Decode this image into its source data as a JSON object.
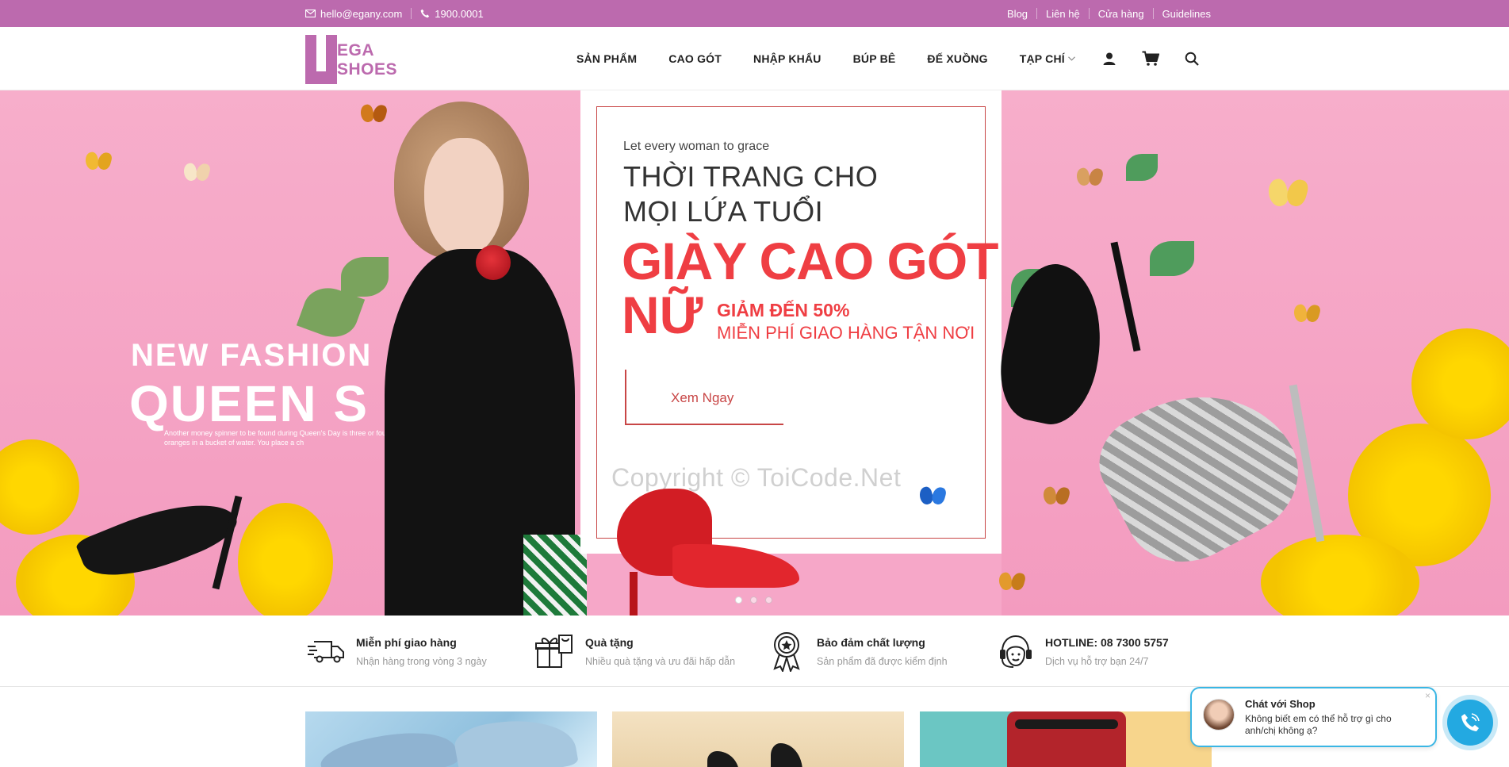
{
  "topbar": {
    "email": "hello@egany.com",
    "phone": "1900.0001",
    "links": [
      "Blog",
      "Liên hệ",
      "Cửa hàng",
      "Guidelines"
    ]
  },
  "logo": {
    "line1": "EGA",
    "line2": "SHOES"
  },
  "nav": {
    "items": [
      "SẢN PHẨM",
      "CAO GÓT",
      "NHẬP KHẨU",
      "BÚP BÊ",
      "ĐẾ XUỒNG",
      "TẠP CHÍ"
    ],
    "icons": [
      "user-icon",
      "cart-icon",
      "search-icon"
    ]
  },
  "hero": {
    "left_small": "NEW FASHION",
    "left_big": "QUEEN S",
    "left_desc": "Another money spinner to be found during Queen's Day is three or four oranges in a bucket of water. You place a ch",
    "tagline": "Let every woman to grace",
    "headline": "THỜI TRANG CHO MỌI LỨA TUỔI",
    "product_line1": "GIÀY CAO GÓT",
    "product_line2": "NỮ",
    "promo_discount": "GIẢM ĐẾN 50%",
    "promo_shipping": "MIỄN PHÍ GIAO HÀNG TẬN NƠI",
    "cta": "Xem Ngay",
    "watermark": "Copyright © ToiCode.Net",
    "slides": 3,
    "active_slide": 1
  },
  "services": [
    {
      "title": "Miễn phí giao hàng",
      "subtitle": "Nhận hàng trong vòng 3 ngày",
      "icon": "delivery-truck-icon"
    },
    {
      "title": "Quà tặng",
      "subtitle": "Nhiều quà tặng và ưu đãi hấp dẫn",
      "icon": "gift-icon"
    },
    {
      "title": "Bảo đảm chất lượng",
      "subtitle": "Sản phẩm đã được kiểm định",
      "icon": "quality-badge-icon"
    },
    {
      "title": "HOTLINE: 08 7300 5757",
      "subtitle": "Dịch vụ hỗ trợ bạn 24/7",
      "icon": "headset-icon"
    }
  ],
  "chat": {
    "title": "Chát với Shop",
    "message": "Không biết em có thể hỗ trợ gì cho anh/chị không ạ?",
    "close": "×"
  },
  "colors": {
    "brand": "#bc6aae",
    "accent_red": "#ef3e43",
    "hero_pink": "#f6a7c8",
    "chat_blue": "#23a9e1"
  }
}
